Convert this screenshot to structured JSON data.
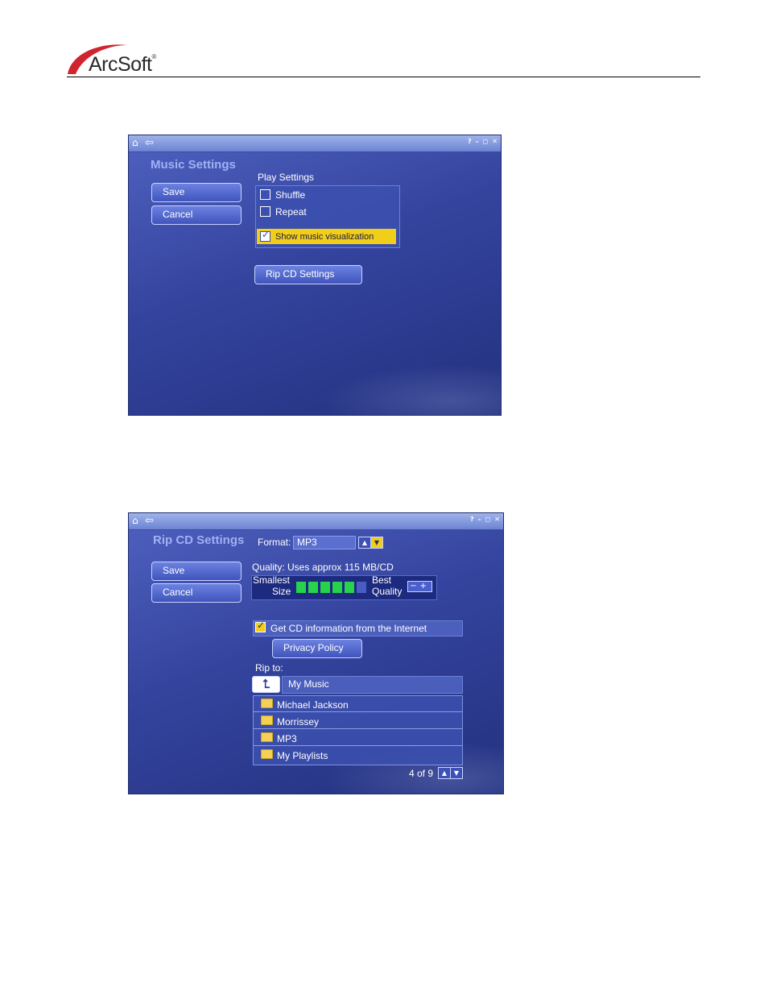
{
  "header": {
    "logo_text": "ArcSoft",
    "logo_reg": "®"
  },
  "music_settings": {
    "title": "Music Settings",
    "save_label": "Save",
    "cancel_label": "Cancel",
    "play_settings_label": "Play Settings",
    "options": [
      {
        "label": "Shuffle",
        "checked": false
      },
      {
        "label": "Repeat",
        "checked": false
      },
      {
        "label": "Show music visualization",
        "checked": true
      }
    ],
    "rip_button": "Rip CD Settings"
  },
  "rip_settings": {
    "title": "Rip CD Settings",
    "save_label": "Save",
    "cancel_label": "Cancel",
    "format_label": "Format:",
    "format_value": "MP3",
    "quality_text": "Quality: Uses approx 115 MB/CD",
    "smallest_label_1": "Smallest",
    "smallest_label_2": "Size",
    "best_label_1": "Best",
    "best_label_2": "Quality",
    "quality_level": 5,
    "quality_max": 6,
    "internet_label": "Get CD information from the Internet",
    "internet_checked": true,
    "privacy_label": "Privacy Policy",
    "rip_to_label": "Rip to:",
    "path_value": "My Music",
    "folders": [
      "Michael Jackson",
      "Morrissey",
      "MP3",
      "My Playlists"
    ],
    "page_indicator": "4 of 9"
  },
  "colors": {
    "accent_yellow": "#f1ce19",
    "quality_green": "#27d34b",
    "title_blue": "#9fb1f5"
  },
  "icons": [
    "home-icon",
    "back-icon",
    "help-icon",
    "minimize-icon",
    "restore-icon",
    "close-icon",
    "checkmark-icon",
    "folder-icon",
    "up-arrow-icon",
    "down-arrow-icon",
    "up-folder-icon"
  ]
}
